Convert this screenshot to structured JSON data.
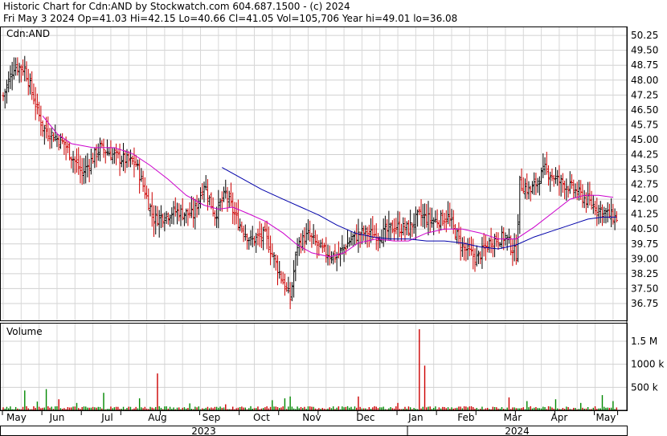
{
  "header": {
    "line1": "Historic Chart for Cdn:AND by Stockwatch.com 604.687.1500 - (c) 2024",
    "line2": "Fri May  3 2024   Op=41.03   Hi=42.15   Lo=40.66   Cl=41.05   Vol=105,706   Year hi=49.01   lo=36.08"
  },
  "chart_data": [
    {
      "type": "ohlc",
      "title": "Cdn:AND",
      "ylim": [
        35.9,
        50.7
      ],
      "y_ticks": [
        "50.25",
        "49.50",
        "48.75",
        "48.00",
        "47.25",
        "46.50",
        "45.75",
        "45.00",
        "44.25",
        "43.50",
        "42.75",
        "42.00",
        "41.25",
        "40.50",
        "39.75",
        "39.00",
        "38.25",
        "37.50",
        "36.75"
      ],
      "x_ticks": [
        "May",
        "Jun",
        "Jul",
        "Aug",
        "Sep",
        "Oct",
        "Nov",
        "Dec",
        "Jan",
        "Feb",
        "Mar",
        "Apr",
        "May"
      ],
      "year_labels": [
        "2023",
        "2024"
      ],
      "grid": true,
      "colors": {
        "up": "#000000",
        "down": "#cc0000",
        "ma_fast": "#cc00cc",
        "ma_slow": "#0000aa"
      },
      "anchors": [
        {
          "i": 0,
          "p": 47.2
        },
        {
          "i": 6,
          "p": 48.7
        },
        {
          "i": 12,
          "p": 48.6
        },
        {
          "i": 22,
          "p": 45.6
        },
        {
          "i": 34,
          "p": 44.8
        },
        {
          "i": 44,
          "p": 43.3
        },
        {
          "i": 54,
          "p": 44.6
        },
        {
          "i": 64,
          "p": 44.1
        },
        {
          "i": 74,
          "p": 43.8
        },
        {
          "i": 84,
          "p": 41.0
        },
        {
          "i": 96,
          "p": 41.4
        },
        {
          "i": 106,
          "p": 41.2
        },
        {
          "i": 112,
          "p": 42.8
        },
        {
          "i": 118,
          "p": 41.2
        },
        {
          "i": 124,
          "p": 42.3
        },
        {
          "i": 130,
          "p": 41.0
        },
        {
          "i": 138,
          "p": 39.9
        },
        {
          "i": 146,
          "p": 40.2
        },
        {
          "i": 154,
          "p": 38.3
        },
        {
          "i": 160,
          "p": 37.0
        },
        {
          "i": 164,
          "p": 39.7
        },
        {
          "i": 170,
          "p": 40.2
        },
        {
          "i": 178,
          "p": 39.4
        },
        {
          "i": 186,
          "p": 39.1
        },
        {
          "i": 194,
          "p": 40.0
        },
        {
          "i": 200,
          "p": 40.3
        },
        {
          "i": 210,
          "p": 40.2
        },
        {
          "i": 218,
          "p": 40.6
        },
        {
          "i": 226,
          "p": 40.5
        },
        {
          "i": 232,
          "p": 41.2
        },
        {
          "i": 240,
          "p": 40.9
        },
        {
          "i": 248,
          "p": 41.1
        },
        {
          "i": 256,
          "p": 39.6
        },
        {
          "i": 264,
          "p": 39.0
        },
        {
          "i": 272,
          "p": 39.9
        },
        {
          "i": 280,
          "p": 40.1
        },
        {
          "i": 286,
          "p": 39.2
        },
        {
          "i": 288,
          "p": 42.8
        },
        {
          "i": 294,
          "p": 42.4
        },
        {
          "i": 302,
          "p": 43.5
        },
        {
          "i": 310,
          "p": 42.9
        },
        {
          "i": 318,
          "p": 42.5
        },
        {
          "i": 326,
          "p": 41.9
        },
        {
          "i": 332,
          "p": 41.5
        },
        {
          "i": 338,
          "p": 41.2
        },
        {
          "i": 342,
          "p": 41.05
        }
      ],
      "ma_fast": [
        [
          22,
          46.2
        ],
        [
          30,
          45.3
        ],
        [
          38,
          44.8
        ],
        [
          50,
          44.6
        ],
        [
          62,
          44.6
        ],
        [
          72,
          44.3
        ],
        [
          82,
          43.7
        ],
        [
          92,
          43.0
        ],
        [
          102,
          42.2
        ],
        [
          112,
          41.7
        ],
        [
          120,
          41.5
        ],
        [
          128,
          41.6
        ],
        [
          136,
          41.3
        ],
        [
          146,
          40.9
        ],
        [
          156,
          40.3
        ],
        [
          164,
          39.7
        ],
        [
          172,
          39.3
        ],
        [
          182,
          39.1
        ],
        [
          190,
          39.3
        ],
        [
          198,
          39.8
        ],
        [
          208,
          40.0
        ],
        [
          218,
          39.9
        ],
        [
          226,
          39.9
        ],
        [
          236,
          40.3
        ],
        [
          246,
          40.5
        ],
        [
          256,
          40.5
        ],
        [
          266,
          40.3
        ],
        [
          276,
          40.0
        ],
        [
          286,
          40.0
        ],
        [
          296,
          40.6
        ],
        [
          306,
          41.3
        ],
        [
          316,
          42.0
        ],
        [
          324,
          42.2
        ],
        [
          332,
          42.2
        ],
        [
          340,
          42.1
        ]
      ],
      "ma_slow": [
        [
          122,
          43.6
        ],
        [
          132,
          43.1
        ],
        [
          144,
          42.5
        ],
        [
          156,
          42.0
        ],
        [
          166,
          41.6
        ],
        [
          176,
          41.2
        ],
        [
          186,
          40.7
        ],
        [
          196,
          40.3
        ],
        [
          206,
          40.1
        ],
        [
          216,
          40.0
        ],
        [
          226,
          40.0
        ],
        [
          236,
          39.9
        ],
        [
          246,
          39.9
        ],
        [
          256,
          39.8
        ],
        [
          266,
          39.6
        ],
        [
          276,
          39.5
        ],
        [
          286,
          39.7
        ],
        [
          296,
          40.1
        ],
        [
          306,
          40.4
        ],
        [
          316,
          40.7
        ],
        [
          326,
          41.0
        ],
        [
          334,
          41.1
        ],
        [
          342,
          41.1
        ]
      ]
    },
    {
      "type": "bar",
      "title": "Volume",
      "ylim": [
        0,
        1900000
      ],
      "y_ticks": [
        {
          "v": 500000,
          "label": "500 k"
        },
        {
          "v": 1000000,
          "label": "1000 k"
        },
        {
          "v": 1500000,
          "label": "1.5 M"
        }
      ],
      "spikes": [
        {
          "i": 12,
          "v": 430000,
          "c": "#008800"
        },
        {
          "i": 19,
          "v": 190000,
          "c": "#008800"
        },
        {
          "i": 24,
          "v": 460000,
          "c": "#008800"
        },
        {
          "i": 31,
          "v": 240000,
          "c": "#cc0000"
        },
        {
          "i": 41,
          "v": 160000,
          "c": "#008800"
        },
        {
          "i": 56,
          "v": 380000,
          "c": "#008800"
        },
        {
          "i": 76,
          "v": 260000,
          "c": "#008800"
        },
        {
          "i": 86,
          "v": 800000,
          "c": "#cc0000"
        },
        {
          "i": 104,
          "v": 150000,
          "c": "#008800"
        },
        {
          "i": 124,
          "v": 130000,
          "c": "#cc0000"
        },
        {
          "i": 150,
          "v": 220000,
          "c": "#008800"
        },
        {
          "i": 157,
          "v": 260000,
          "c": "#008800"
        },
        {
          "i": 160,
          "v": 300000,
          "c": "#008800"
        },
        {
          "i": 198,
          "v": 300000,
          "c": "#cc0000"
        },
        {
          "i": 220,
          "v": 160000,
          "c": "#cc0000"
        },
        {
          "i": 232,
          "v": 1760000,
          "c": "#cc0000"
        },
        {
          "i": 235,
          "v": 970000,
          "c": "#cc0000"
        },
        {
          "i": 282,
          "v": 280000,
          "c": "#cc0000"
        },
        {
          "i": 292,
          "v": 200000,
          "c": "#008800"
        },
        {
          "i": 308,
          "v": 240000,
          "c": "#008800"
        },
        {
          "i": 322,
          "v": 160000,
          "c": "#008800"
        },
        {
          "i": 334,
          "v": 330000,
          "c": "#008800"
        },
        {
          "i": 340,
          "v": 200000,
          "c": "#008800"
        }
      ]
    }
  ]
}
